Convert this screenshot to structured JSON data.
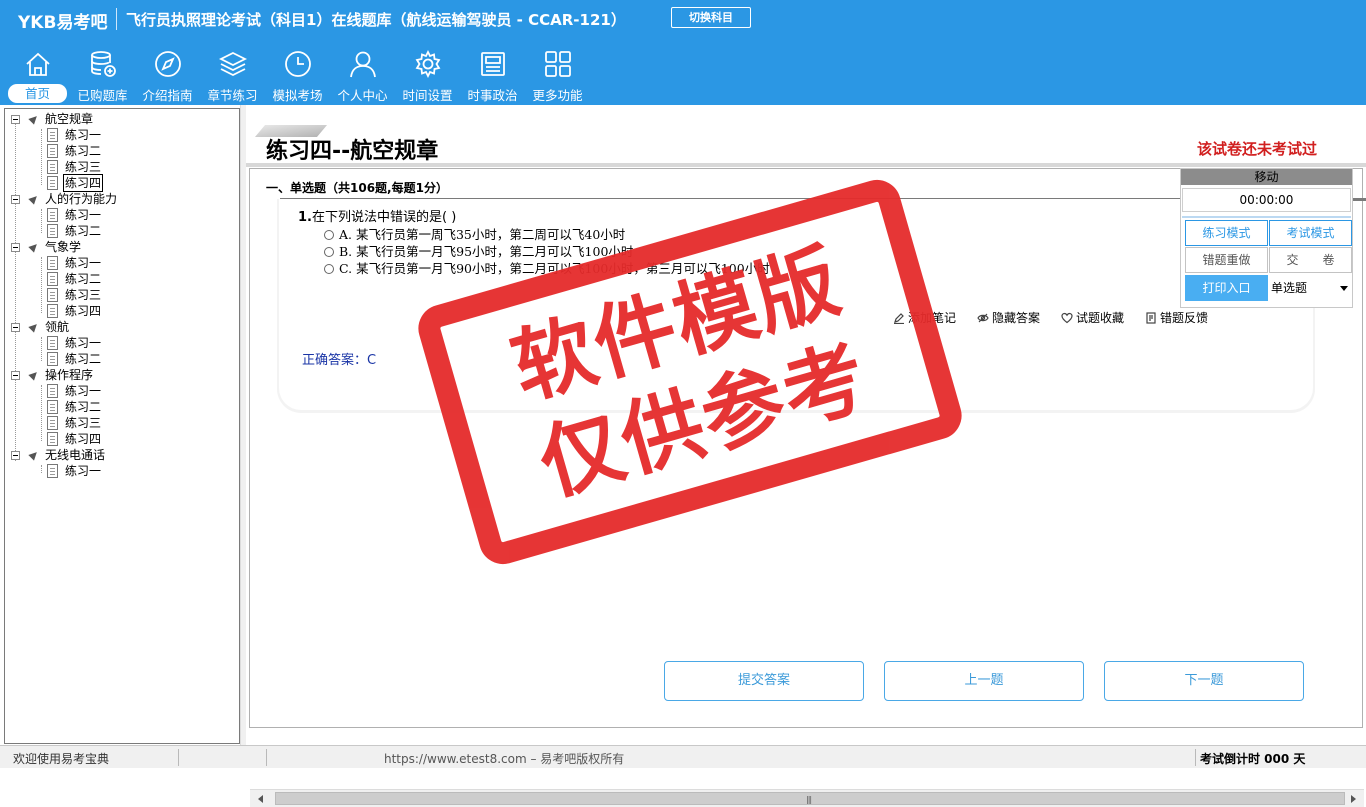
{
  "app": {
    "logo": "YKB易考吧",
    "title": "飞行员执照理论考试（科目1）在线题库（航线运输驾驶员 - CCAR-121）",
    "switch_subject": "切换科目"
  },
  "nav": [
    {
      "label": "首页",
      "icon": "home-icon"
    },
    {
      "label": "已购题库",
      "icon": "database-add-icon"
    },
    {
      "label": "介绍指南",
      "icon": "compass-icon"
    },
    {
      "label": "章节练习",
      "icon": "layers-icon"
    },
    {
      "label": "模拟考场",
      "icon": "clock-icon"
    },
    {
      "label": "个人中心",
      "icon": "user-icon"
    },
    {
      "label": "时间设置",
      "icon": "gear-icon"
    },
    {
      "label": "时事政治",
      "icon": "news-icon"
    },
    {
      "label": "更多功能",
      "icon": "grid-icon"
    }
  ],
  "tree": {
    "c0": {
      "label": "航空规章",
      "items": [
        "练习一",
        "练习二",
        "练习三",
        "练习四"
      ]
    },
    "c1": {
      "label": "人的行为能力",
      "items": [
        "练习一",
        "练习二"
      ]
    },
    "c2": {
      "label": "气象学",
      "items": [
        "练习一",
        "练习二",
        "练习三",
        "练习四"
      ]
    },
    "c3": {
      "label": "领航",
      "items": [
        "练习一",
        "练习二"
      ]
    },
    "c4": {
      "label": "操作程序",
      "items": [
        "练习一",
        "练习二",
        "练习三",
        "练习四"
      ]
    },
    "c5": {
      "label": "无线电通话",
      "items": [
        "练习一"
      ]
    }
  },
  "paper": {
    "title": "练习四--航空规章",
    "status": "该试卷还未考试过",
    "section": "一、单选题（共106题,每题1分）"
  },
  "question": {
    "number": "1.",
    "text": "在下列说法中错误的是( )",
    "options": [
      "A. 某飞行员第一周飞35小时，第二周可以飞40小时",
      "B. 某飞行员第一月飞95小时，第二月可以飞100小时",
      "C. 某飞行员第一月飞90小时，第二月可以飞100小时，第三月可以飞100小时"
    ],
    "answer": "正确答案：C"
  },
  "tools": {
    "add_note": "添加笔记",
    "hide_answer": "隐藏答案",
    "favorite": "试题收藏",
    "report": "错题反馈"
  },
  "buttons": {
    "submit": "提交答案",
    "prev": "上一题",
    "next": "下一题"
  },
  "panel": {
    "move": "移动",
    "timer": "00:00:00",
    "practice_mode": "练习模式",
    "exam_mode": "考试模式",
    "redo_wrong": "错题重做",
    "hand_in": "交　　卷",
    "print": "打印入口",
    "question_type": "单选题"
  },
  "watermark": {
    "line1": "软件模版",
    "line2": "仅供参考"
  },
  "status": {
    "welcome": "欢迎使用易考宝典",
    "copyright": "https://www.etest8.com – 易考吧版权所有",
    "countdown": "考试倒计时 000 天"
  },
  "colors": {
    "header": "#2b97e4",
    "stamp": "#e52b2b",
    "status_red": "#d11f1f"
  }
}
